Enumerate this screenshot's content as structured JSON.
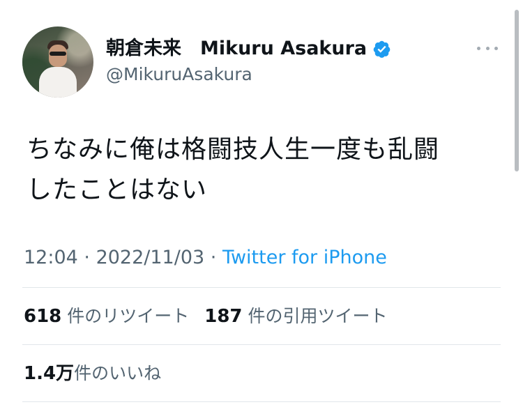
{
  "tweet": {
    "author": {
      "display_name": "朝倉未来　Mikuru Asakura",
      "handle": "@MikuruAsakura",
      "verified_icon": "verified-badge-icon",
      "verified_color": "#1d9bf0"
    },
    "more_icon": "more-dots-icon",
    "text_line1": "ちなみに俺は格闘技人生一度も乱闘",
    "text_line2": "したことはない",
    "time": "12:04",
    "separator": " · ",
    "date": "2022/11/03",
    "source": "Twitter for iPhone",
    "retweets": {
      "count": "618",
      "label": "件のリツイート"
    },
    "quotes": {
      "count": "187",
      "label": "件の引用ツイート"
    },
    "likes": {
      "count": "1.4万",
      "label": "件のいいね"
    }
  }
}
